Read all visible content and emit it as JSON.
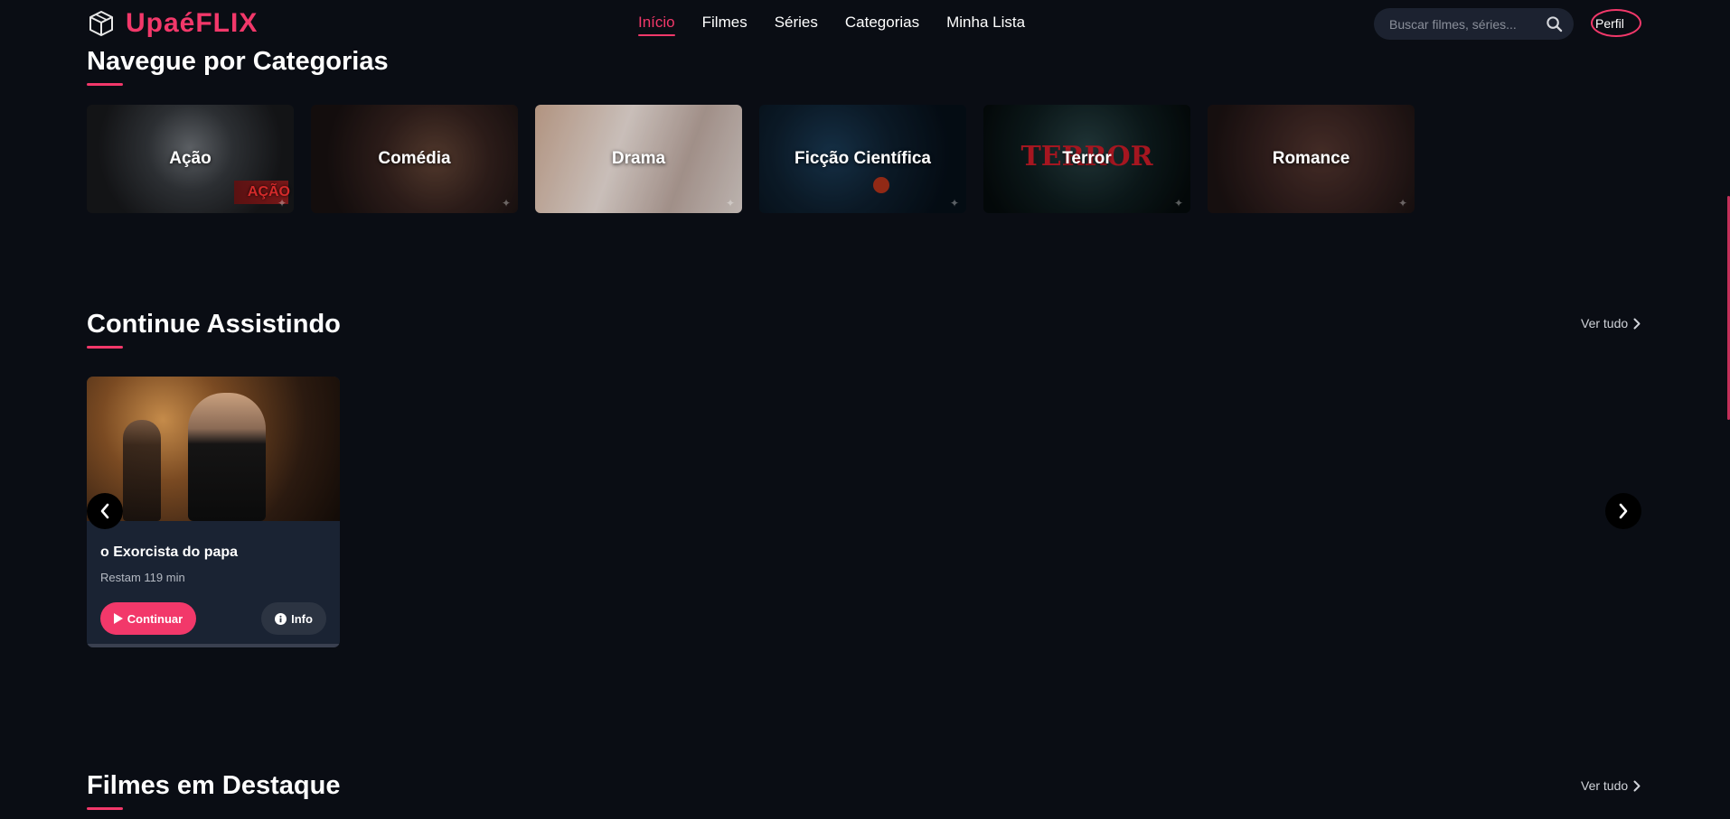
{
  "brand": {
    "name": "UpaéFLIX",
    "accent": "#f2386a"
  },
  "nav": {
    "items": [
      {
        "label": "Início",
        "active": true
      },
      {
        "label": "Filmes",
        "active": false
      },
      {
        "label": "Séries",
        "active": false
      },
      {
        "label": "Categorias",
        "active": false
      },
      {
        "label": "Minha Lista",
        "active": false
      }
    ]
  },
  "search": {
    "placeholder": "Buscar filmes, séries..."
  },
  "profile": {
    "alt_text": "Perfil"
  },
  "categories": {
    "title": "Navegue por Categorias",
    "items": [
      {
        "label": "Ação",
        "image_text": "AÇÃO"
      },
      {
        "label": "Comédia"
      },
      {
        "label": "Drama"
      },
      {
        "label": "Ficção Científica"
      },
      {
        "label": "Terror",
        "image_text": "TERROR"
      },
      {
        "label": "Romance"
      }
    ]
  },
  "continue_watching": {
    "title": "Continue Assistindo",
    "see_all": "Ver tudo",
    "items": [
      {
        "title": "o Exorcista do papa",
        "remaining": "Restam 119 min",
        "continue_label": "Continuar",
        "info_label": "Info"
      }
    ]
  },
  "featured": {
    "title": "Filmes em Destaque",
    "see_all": "Ver tudo"
  },
  "icons": {
    "logo": "box-icon",
    "search": "search-icon",
    "chevron": "chevron-right-icon",
    "play": "play-icon",
    "info": "info-icon",
    "prev": "chevron-left-icon",
    "next": "chevron-right-icon"
  }
}
